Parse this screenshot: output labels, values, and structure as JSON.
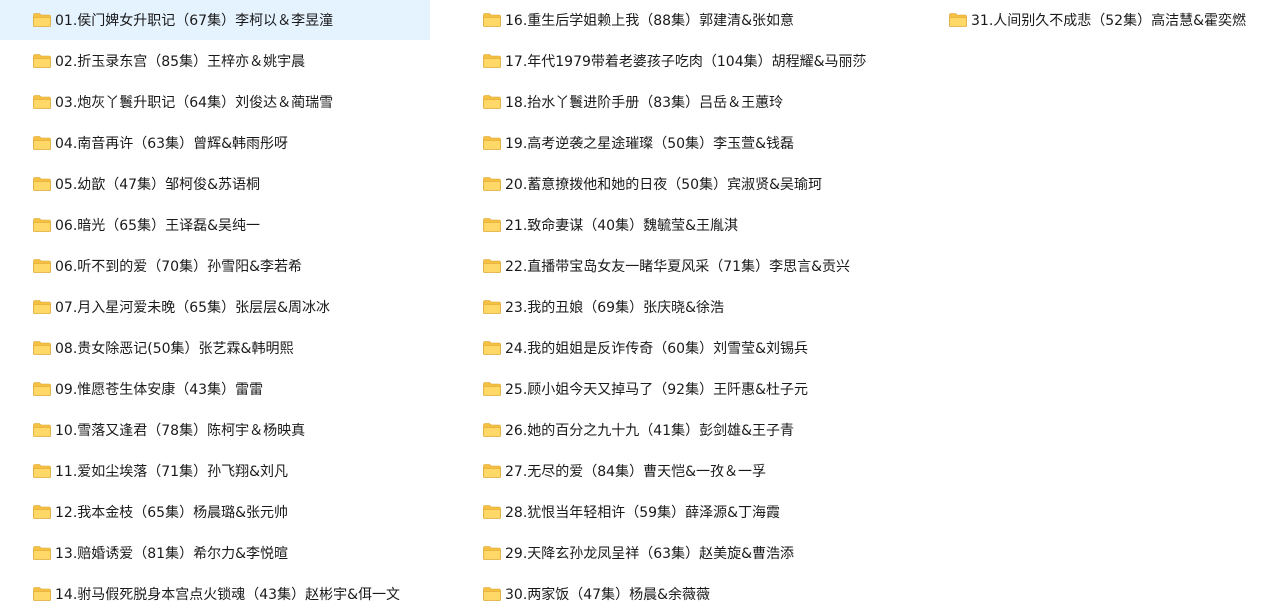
{
  "folders": [
    {
      "name": "01.侯门婢女升职记（67集）李柯以＆李昱潼",
      "icon": "folder-icon",
      "selected": true
    },
    {
      "name": "02.折玉录东宫（85集）王梓亦＆姚宇晨",
      "icon": "folder-icon"
    },
    {
      "name": "03.炮灰丫鬟升职记（64集）刘俊达＆蔺瑞雪",
      "icon": "folder-icon"
    },
    {
      "name": "04.南音再许（63集）曾辉&韩雨彤呀",
      "icon": "folder-icon"
    },
    {
      "name": "05.幼歆（47集）邹柯俊&苏语桐",
      "icon": "folder-icon"
    },
    {
      "name": "06.暗光（65集）王译磊&吴纯一",
      "icon": "folder-icon"
    },
    {
      "name": "06.听不到的爱（70集）孙雪阳&李若希",
      "icon": "folder-icon"
    },
    {
      "name": "07.月入星河爱未晚（65集）张层层&周冰冰",
      "icon": "folder-icon"
    },
    {
      "name": "08.贵女除恶记(50集）张艺霖&韩明熙",
      "icon": "folder-icon"
    },
    {
      "name": "09.惟愿苍生体安康（43集）雷雷",
      "icon": "folder-icon"
    },
    {
      "name": "10.雪落又逢君（78集）陈柯宇＆杨映真",
      "icon": "folder-icon"
    },
    {
      "name": "11.爱如尘埃落（71集）孙飞翔&刘凡",
      "icon": "folder-icon"
    },
    {
      "name": "12.我本金枝（65集）杨晨璐&张元帅",
      "icon": "folder-icon"
    },
    {
      "name": "13.赔婚诱爱（81集）希尔力&李悦暄",
      "icon": "folder-icon"
    },
    {
      "name": "14.驸马假死脱身本宫点火锁魂（43集）赵彬宇&佴一文",
      "icon": "folder-icon"
    },
    {
      "name": "16.重生后学姐赖上我（88集）郭建清&张如意",
      "icon": "folder-icon"
    },
    {
      "name": "17.年代1979带着老婆孩子吃肉（104集）胡程耀&马丽莎",
      "icon": "folder-icon"
    },
    {
      "name": "18.抬水丫鬟进阶手册（83集）吕岳＆王蕙玲",
      "icon": "folder-icon"
    },
    {
      "name": "19.高考逆袭之星途璀璨（50集）李玉萱&钱磊",
      "icon": "folder-icon"
    },
    {
      "name": "20.蓄意撩拨他和她的日夜（50集）宾淑贤&吴瑜珂",
      "icon": "folder-icon"
    },
    {
      "name": "21.致命妻谋（40集）魏毓莹&王胤淇",
      "icon": "folder-icon"
    },
    {
      "name": "22.直播带宝岛女友一睹华夏风采（71集）李思言&贡兴",
      "icon": "folder-icon"
    },
    {
      "name": "23.我的丑娘（69集）张庆晓&徐浩",
      "icon": "folder-icon"
    },
    {
      "name": "24.我的姐姐是反诈传奇（60集）刘雪莹&刘锡兵",
      "icon": "folder-icon"
    },
    {
      "name": "25.顾小姐今天又掉马了（92集）王阡惠&杜子元",
      "icon": "folder-icon"
    },
    {
      "name": "26.她的百分之九十九（41集）彭剑雄&王子青",
      "icon": "folder-icon"
    },
    {
      "name": "27.无尽的爱（84集）曹天恺&一孜＆一孚",
      "icon": "folder-icon"
    },
    {
      "name": "28.犹恨当年轻相许（59集）薛泽源&丁海霞",
      "icon": "folder-icon"
    },
    {
      "name": "29.天降玄孙龙凤呈祥（63集）赵美旋&曹浩添",
      "icon": "folder-icon"
    },
    {
      "name": "30.两家饭（47集）杨晨&余薇薇",
      "icon": "folder-icon"
    },
    {
      "name": "31.人间别久不成悲（52集）高洁慧&霍奕燃",
      "icon": "folder-icon"
    }
  ],
  "colors": {
    "folder_body": "#ffd868",
    "folder_back": "#f6c143",
    "folder_edge": "#d8a22a",
    "selection": "#e5f3ff",
    "text": "#1a1a1a"
  }
}
